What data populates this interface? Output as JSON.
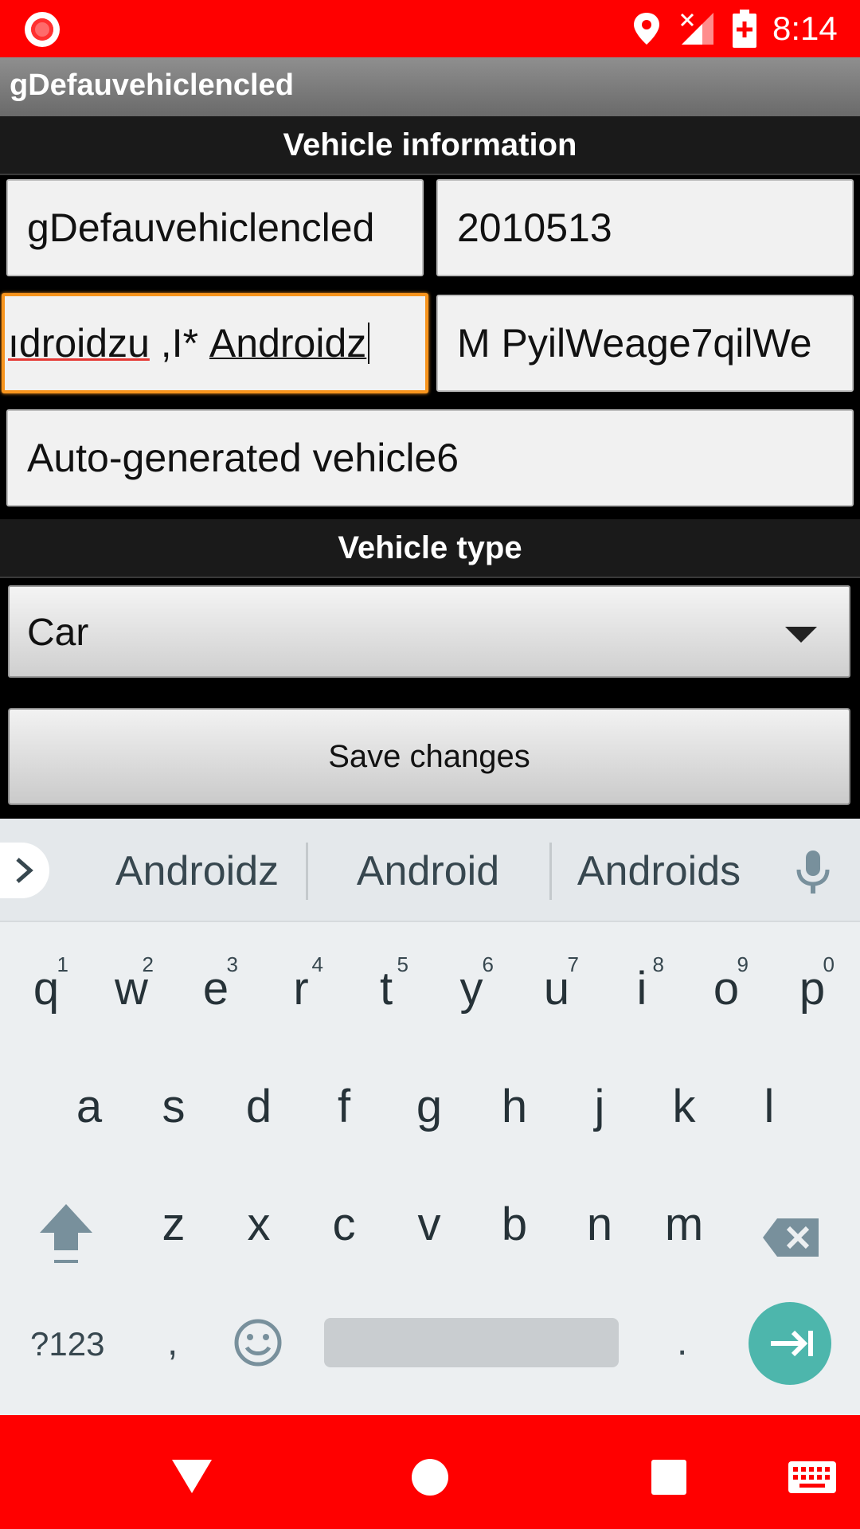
{
  "status_bar": {
    "time": "8:14",
    "icons": [
      "screen-record-icon",
      "location-icon",
      "no-signal-icon",
      "battery-charging-icon"
    ],
    "color": "#ff0000"
  },
  "app_bar": {
    "title": "gDefauvehiclencled"
  },
  "vehicle_info": {
    "header": "Vehicle information",
    "name_field": "gDefauvehiclencled",
    "year_field": "2010513",
    "make_field": {
      "value_part1": "ıdroidzu",
      "value_part2": " ,I* ",
      "value_part3": "Androidz"
    },
    "model_field": "M PyilWeage7qilWe",
    "description_field": "Auto-generated vehicle6"
  },
  "vehicle_type": {
    "header": "Vehicle type",
    "selected": "Car"
  },
  "save_button": {
    "label": "Save changes"
  },
  "keyboard": {
    "suggestions": [
      "Androidz",
      "Android",
      "Androids"
    ],
    "row1": [
      {
        "key": "q",
        "hint": "1"
      },
      {
        "key": "w",
        "hint": "2"
      },
      {
        "key": "e",
        "hint": "3"
      },
      {
        "key": "r",
        "hint": "4"
      },
      {
        "key": "t",
        "hint": "5"
      },
      {
        "key": "y",
        "hint": "6"
      },
      {
        "key": "u",
        "hint": "7"
      },
      {
        "key": "i",
        "hint": "8"
      },
      {
        "key": "o",
        "hint": "9"
      },
      {
        "key": "p",
        "hint": "0"
      }
    ],
    "row2": [
      "a",
      "s",
      "d",
      "f",
      "g",
      "h",
      "j",
      "k",
      "l"
    ],
    "row3": [
      "z",
      "x",
      "c",
      "v",
      "b",
      "n",
      "m"
    ],
    "symbols_key": "?123",
    "comma_key": ",",
    "period_key": ".",
    "accent_color": "#4db6ac"
  },
  "nav_bar": {
    "icons": [
      "back-icon",
      "home-icon",
      "recents-icon",
      "keyboard-icon"
    ],
    "color": "#ff0000"
  }
}
